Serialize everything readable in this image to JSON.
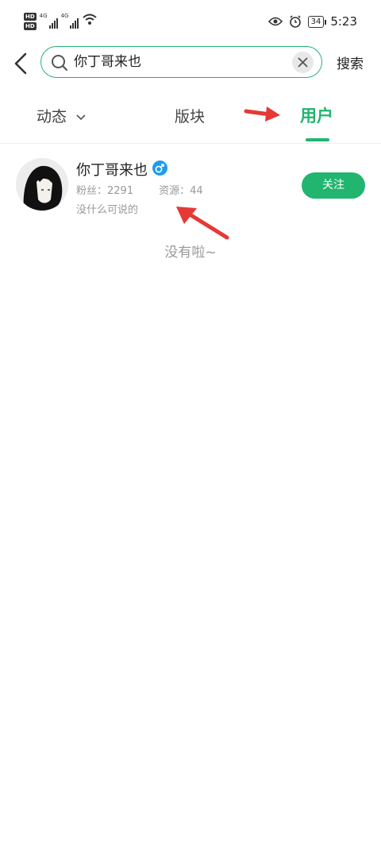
{
  "status_bar": {
    "network_badge": "HD",
    "network_type": "4G",
    "battery": "34",
    "time": "5:23"
  },
  "search": {
    "query": "你丁哥来也",
    "search_label": "搜索"
  },
  "tabs": {
    "dynamic": "动态",
    "board": "版块",
    "user": "用户"
  },
  "user_result": {
    "name": "你丁哥来也",
    "fans_label": "粉丝：",
    "fans": "2291",
    "resources_label": "资源：",
    "resources": "44",
    "bio": "没什么可说的",
    "follow_label": "关注"
  },
  "end_text": "没有啦~",
  "colors": {
    "accent": "#21b56f",
    "gender": "#1e9cf0",
    "annotation": "#e53935"
  }
}
